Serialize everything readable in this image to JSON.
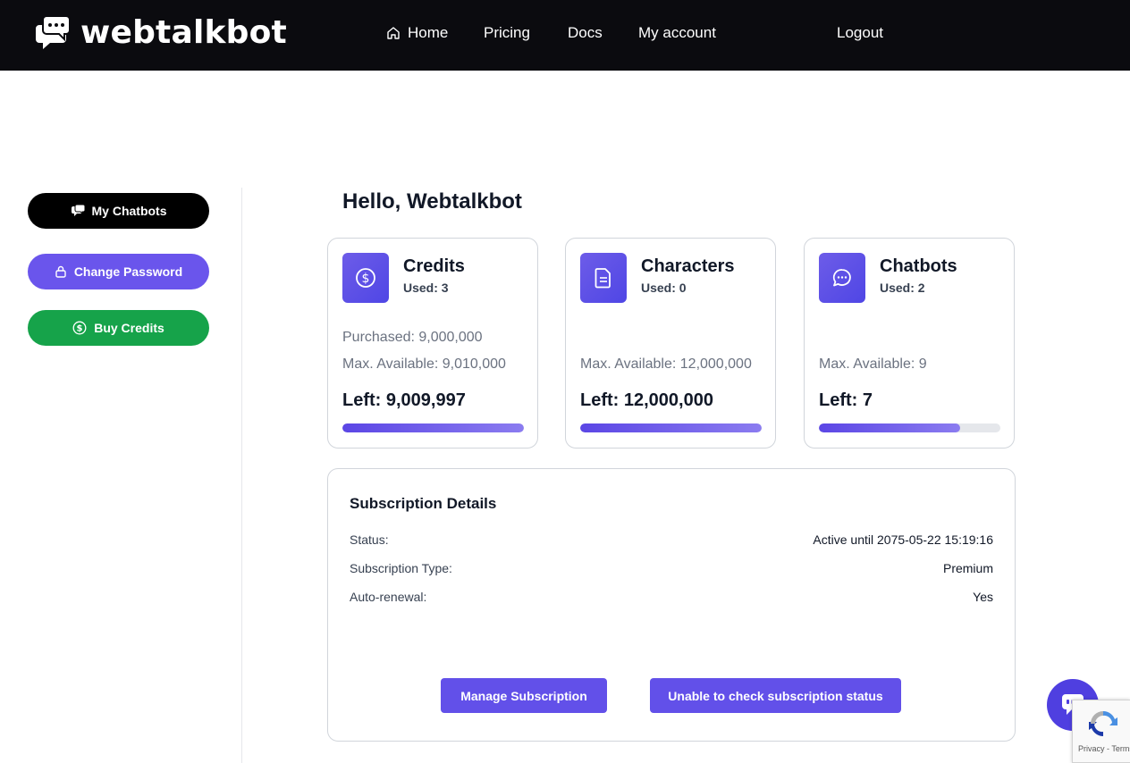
{
  "brand": {
    "name": "webtalkbot"
  },
  "nav": {
    "home": "Home",
    "pricing": "Pricing",
    "docs": "Docs",
    "account": "My account",
    "logout": "Logout"
  },
  "sidebar": {
    "my_chatbots": "My Chatbots",
    "change_password": "Change Password",
    "buy_credits": "Buy Credits"
  },
  "greeting": "Hello, Webtalkbot",
  "cards": [
    {
      "icon": "dollar-circle-icon",
      "title": "Credits",
      "used": "Used: 3",
      "purchased": "Purchased: 9,000,000",
      "max": "Max. Available: 9,010,000",
      "left": "Left: 9,009,997",
      "progress": 1.0
    },
    {
      "icon": "document-icon",
      "title": "Characters",
      "used": "Used: 0",
      "purchased": "",
      "max": "Max. Available: 12,000,000",
      "left": "Left: 12,000,000",
      "progress": 1.0
    },
    {
      "icon": "chat-bubble-icon",
      "title": "Chatbots",
      "used": "Used: 2",
      "purchased": "",
      "max": "Max. Available: 9",
      "left": "Left: 7",
      "progress": 0.778
    }
  ],
  "subscription": {
    "title": "Subscription Details",
    "rows": [
      {
        "label": "Status:",
        "value": "Active until 2075-05-22 15:19:16"
      },
      {
        "label": "Subscription Type:",
        "value": "Premium"
      },
      {
        "label": "Auto-renewal:",
        "value": "Yes"
      }
    ],
    "manage_button": "Manage Subscription",
    "status_button": "Unable to check subscription status"
  },
  "recaptcha": {
    "links": "Privacy - Terms"
  },
  "colors": {
    "accent": "#6250e9",
    "success": "#16a34a",
    "dark": "#0b0b0f"
  }
}
